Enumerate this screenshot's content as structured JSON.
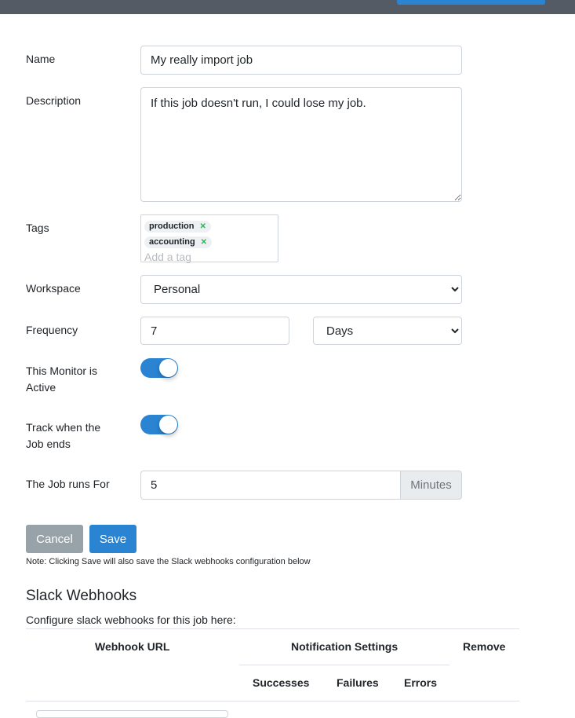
{
  "form": {
    "name_label": "Name",
    "name_value": "My really import job",
    "description_label": "Description",
    "description_value": "If this job doesn't run, I could lose my job.",
    "tags_label": "Tags",
    "tags": [
      {
        "label": "production"
      },
      {
        "label": "accounting"
      }
    ],
    "tags_placeholder": "Add a tag",
    "workspace_label": "Workspace",
    "workspace_value": "Personal",
    "frequency_label": "Frequency",
    "frequency_value": "7",
    "frequency_unit": "Days",
    "active_label": "This Monitor is Active",
    "active_on": true,
    "track_end_label": "Track when the Job ends",
    "track_end_on": true,
    "duration_label": "The Job runs For",
    "duration_value": "5",
    "duration_unit": "Minutes"
  },
  "actions": {
    "cancel_label": "Cancel",
    "save_label": "Save",
    "note": "Note: Clicking Save will also save the Slack webhooks configuration below"
  },
  "slack": {
    "title": "Slack Webhooks",
    "subtitle": "Configure slack webhooks for this job here:",
    "table": {
      "webhook_url": "Webhook URL",
      "notification_settings": "Notification Settings",
      "remove": "Remove",
      "successes": "Successes",
      "failures": "Failures",
      "errors": "Errors"
    }
  },
  "colors": {
    "primary": "#2a84d2",
    "secondary": "#97a3a8",
    "topbar": "#545b65",
    "tag_remove": "#2fb35a"
  }
}
